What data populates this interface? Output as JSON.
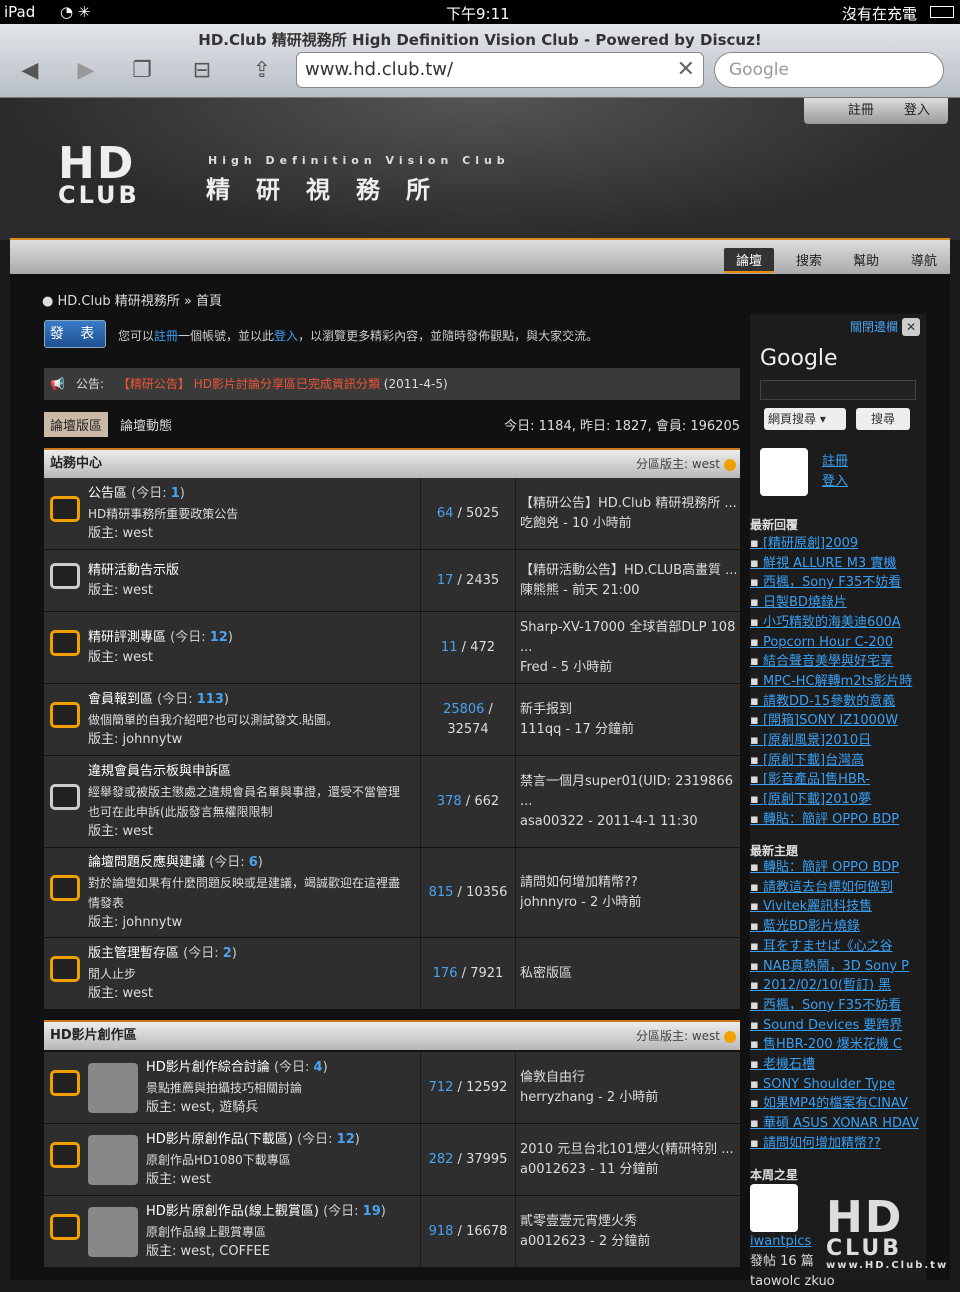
{
  "status": {
    "device": "iPad",
    "time": "下午9:11",
    "battery": "沒有在充電"
  },
  "browser": {
    "title": "HD.Club 精研視務所 High Definition Vision Club - Powered by Discuz!",
    "url": "www.hd.club.tw/",
    "search_placeholder": "Google"
  },
  "header": {
    "login_links": [
      "註冊",
      "登入"
    ],
    "logo_top": "HD",
    "logo_bottom": "CLUB",
    "subtitle": "High Definition Vision Club",
    "name_cn": "精研視務所"
  },
  "nav": {
    "items": [
      "論壇",
      "搜索",
      "幫助",
      "導航"
    ]
  },
  "breadcrumb": {
    "site": "HD.Club 精研視務所",
    "sep": "»",
    "page": "首頁"
  },
  "post_button": "發 表",
  "register_text": {
    "a": "您可以",
    "b": "註冊",
    "c": "一個帳號，並以此",
    "d": "登入",
    "e": "，以瀏覽更多精彩內容，並隨時發佈觀點，與大家交流。"
  },
  "notice": {
    "label": "公告:",
    "text": "【精研公告】 HD影片討論分享區已完成資訊分類",
    "date": "(2011-4-5)"
  },
  "tabs": {
    "tab1": "論壇版區",
    "tab2": "論壇動態",
    "stats": "今日: 1184, 昨日: 1827, 會員: 196205"
  },
  "sections": [
    {
      "title": "站務中心",
      "moderator": "分區版主: west"
    },
    {
      "title": "HD影片創作區",
      "moderator": "分區版主: west"
    }
  ],
  "forums": [
    {
      "name": "公告區",
      "today_prefix": "(今日: ",
      "today": "1",
      "today_suffix": ")",
      "desc": "HD精研事務所重要政策公告",
      "desc2": "",
      "mod": "版主: west",
      "threads": "64",
      "posts": "5025",
      "last1": "【精研公告】HD.Club 精研視務所 ...",
      "last2": "吃飽兇 - 10 小時前"
    },
    {
      "name": "精研活動告示版",
      "today_prefix": "",
      "today": "",
      "today_suffix": "",
      "desc": "",
      "desc2": "",
      "mod": "版主: west",
      "threads": "17",
      "posts": "2435",
      "last1": "【精研活動公告】HD.CLUB高畫質 ...",
      "last2": "陳熊熊 - 前天 21:00"
    },
    {
      "name": "精研評測專區",
      "today_prefix": "(今日: ",
      "today": "12",
      "today_suffix": ")",
      "desc": "",
      "desc2": "",
      "mod": "版主: west",
      "threads": "11",
      "posts": "472",
      "last1": "Sharp-XV-17000 全球首部DLP 108",
      "last1b": "...",
      "last2": "Fred - 5 小時前"
    },
    {
      "name": "會員報到區",
      "today_prefix": "(今日: ",
      "today": "113",
      "today_suffix": ")",
      "desc": "做個簡單的自我介紹吧?也可以測試發文.貼圖。",
      "desc2": "",
      "mod": "版主: johnnytw",
      "threads": "25806",
      "posts": "32574",
      "last1": "新手报到",
      "last2": "111qq - 17 分鐘前"
    },
    {
      "name": "違規會員告示板與申訴區",
      "today_prefix": "",
      "today": "",
      "today_suffix": "",
      "desc": "經舉發或被版主懲處之違規會員名單與事證，還受不當管理",
      "desc2": "也可在此申訴(此版發言無權限限制",
      "mod": "版主: west",
      "threads": "378",
      "posts": "662",
      "last1": "禁言一個月super01(UID: 2319866",
      "last1b": "...",
      "last2": "asa00322 - 2011-4-1 11:30"
    },
    {
      "name": "論壇問題反應與建議",
      "today_prefix": "(今日: ",
      "today": "6",
      "today_suffix": ")",
      "desc": "對於論壇如果有什麼問題反映或是建議，竭誠歡迎在這裡盡",
      "desc2": "情發表",
      "mod": "版主: johnnytw",
      "threads": "815",
      "posts": "10356",
      "last1": "請問如何增加精幣??",
      "last2": "johnnyro - 2 小時前"
    },
    {
      "name": "版主管理暫存區",
      "today_prefix": "(今日: ",
      "today": "2",
      "today_suffix": ")",
      "desc": "閒人止步",
      "desc2": "",
      "mod": "版主: west",
      "threads": "176",
      "posts": "7921",
      "last1": "私密版區",
      "last2": ""
    },
    {
      "name": "HD影片創作綜合討論",
      "today_prefix": "(今日: ",
      "today": "4",
      "today_suffix": ")",
      "desc": "景點推薦與拍攝技巧相關討論",
      "desc2": "",
      "mod": "版主: west, 遊騎兵",
      "threads": "712",
      "posts": "12592",
      "last1": "倫敦自由行",
      "last2": "herryzhang - 2 小時前"
    },
    {
      "name": "HD影片原創作品(下載區)",
      "today_prefix": "(今日: ",
      "today": "12",
      "today_suffix": ")",
      "desc": "原創作品HD1080下載專區",
      "desc2": "",
      "mod": "版主: west",
      "threads": "282",
      "posts": "37995",
      "last1": "2010 元旦台北101煙火(精研特別 ...",
      "last2": "a0012623 - 11 分鐘前"
    },
    {
      "name": "HD影片原創作品(線上觀賞區)",
      "today_prefix": "(今日: ",
      "today": "19",
      "today_suffix": ")",
      "desc": "原創作品線上觀賞專區",
      "desc2": "",
      "mod": "版主: west, COFFEE",
      "threads": "918",
      "posts": "16678",
      "last1": "貳零壹壹元宵煙火秀",
      "last2": "a0012623 - 2 分鐘前"
    }
  ],
  "sidebar": {
    "close": "關閉邊欄",
    "google": "Google",
    "select": "網頁搜尋",
    "search_btn": "搜尋",
    "user_links": [
      "註冊",
      "登入"
    ],
    "recent_replies_title": "最新回覆",
    "recent_replies": [
      "[精研原創]2009",
      "鮮視 ALLURE M3 實機",
      "西楓，Sony F35不妨看",
      "日製BD燒錄片",
      "小巧精致的海美迪600A",
      "Popcorn Hour C-200",
      "結合聲音美學與好宅享",
      "MPC-HC解轉m2ts影片時",
      "請教DD-15參數的意義",
      "[開箱]SONY IZ1000W",
      "[原創風景]2010日",
      "[原創下載]台灣高",
      "[影音產品]售HBR-",
      "[原創下載]2010夢",
      "轉貼：簡評 OPPO BDP"
    ],
    "new_topics_title": "最新主題",
    "new_topics": [
      "轉貼：簡評 OPPO BDP",
      "請教這去台標如何做到",
      "Vivitek麗訊科技售",
      "藍光BD影片燒錄",
      "耳をすませば《心之谷",
      "NAB真熱鬧，3D Sony P",
      "2012/02/10(暫訂) 黑",
      "西楓，Sony F35不妨看",
      "Sound Devices 要跨界",
      "售HBR-200 爆米花機 C",
      "老機石槽",
      "SONY Shoulder Type",
      "如果MP4的檔案有CINAV",
      "華碩 ASUS XONAR HDAV",
      "請問如何增加精幣??"
    ],
    "star_title": "本周之星",
    "star_user": "iwantpics",
    "star_posts": "發帖 16 篇",
    "star_next": "taowolc zkuo"
  },
  "watermark": {
    "top": "HD",
    "bottom": "CLUB",
    "url": "www.HD.Club.tw"
  }
}
